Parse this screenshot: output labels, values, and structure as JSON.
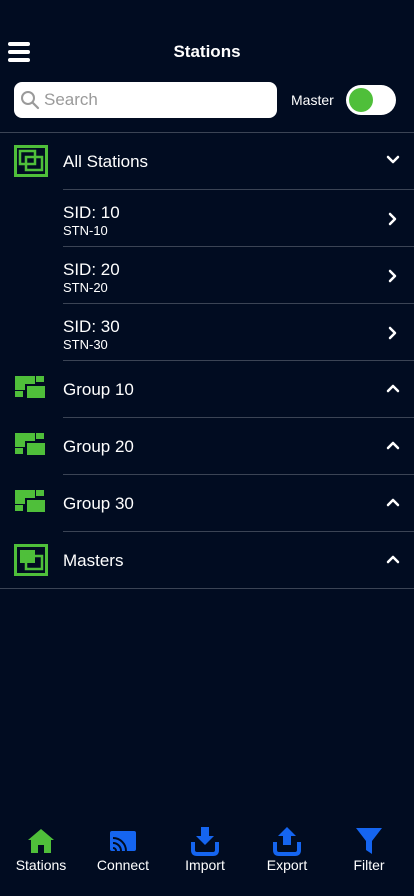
{
  "header": {
    "title": "Stations",
    "menu_icon": "hamburger-icon"
  },
  "search": {
    "placeholder": "Search",
    "value": ""
  },
  "master": {
    "label": "Master",
    "toggle_on": true
  },
  "colors": {
    "background": "#010c21",
    "accent_green": "#4fbf3a",
    "accent_blue": "#1565f0",
    "divider": "#3b4455"
  },
  "list": {
    "all_stations": {
      "label": "All Stations",
      "expanded": true,
      "icon": "stations-icon",
      "stations": [
        {
          "sid": "SID: 10",
          "stn": "STN-10"
        },
        {
          "sid": "SID: 20",
          "stn": "STN-20"
        },
        {
          "sid": "SID: 30",
          "stn": "STN-30"
        }
      ]
    },
    "groups": [
      {
        "label": "Group 10",
        "icon": "group-icon"
      },
      {
        "label": "Group 20",
        "icon": "group-icon"
      },
      {
        "label": "Group 30",
        "icon": "group-icon"
      }
    ],
    "masters": {
      "label": "Masters",
      "icon": "masters-icon"
    }
  },
  "tabbar": {
    "tabs": [
      {
        "label": "Stations",
        "icon": "home-icon",
        "active": true
      },
      {
        "label": "Connect",
        "icon": "cast-icon",
        "active": false
      },
      {
        "label": "Import",
        "icon": "import-icon",
        "active": false
      },
      {
        "label": "Export",
        "icon": "export-icon",
        "active": false
      },
      {
        "label": "Filter",
        "icon": "filter-icon",
        "active": false
      }
    ]
  }
}
